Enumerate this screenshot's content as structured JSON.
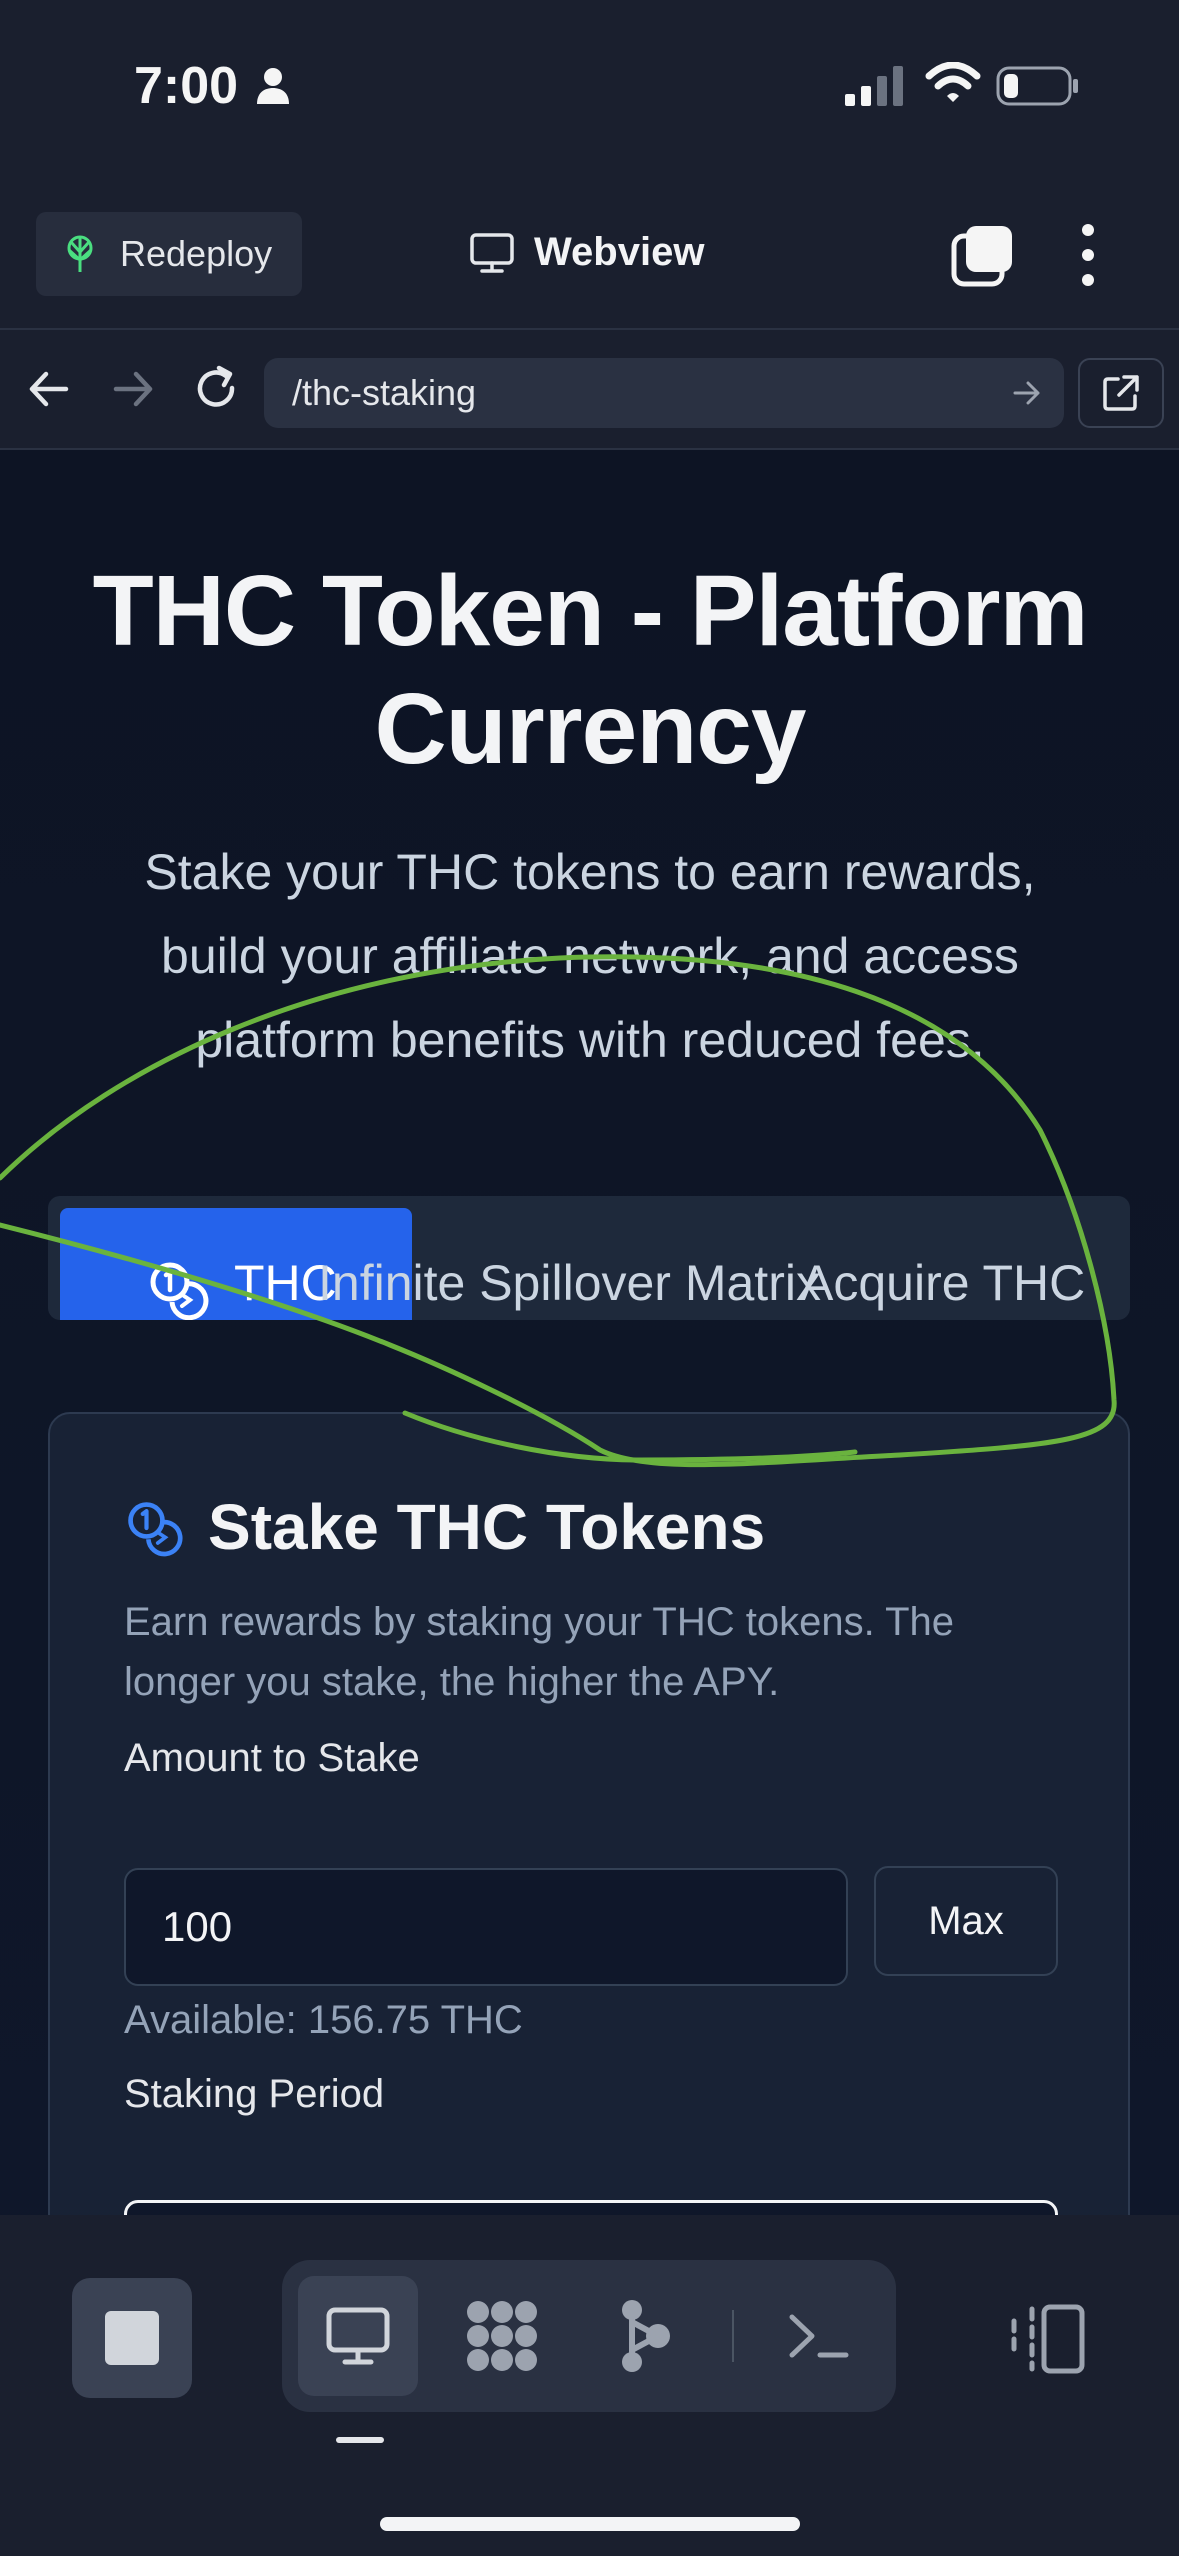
{
  "status_bar": {
    "time": "7:00"
  },
  "toolbar": {
    "redeploy_label": "Redeploy",
    "webview_label": "Webview"
  },
  "nav": {
    "url": "/thc-staking"
  },
  "page": {
    "title_line1": "THC Token - Platform",
    "title_line2": "Currency",
    "subtitle_line1": "Stake your THC tokens to earn rewards,",
    "subtitle_line2": "build your affiliate network, and access",
    "subtitle_line3": "platform benefits with reduced fees."
  },
  "tabs": [
    {
      "label": "THC",
      "active": true
    },
    {
      "label": "Infinite Spillover Matrix",
      "active": false
    },
    {
      "label": "Acquire THC",
      "active": false
    }
  ],
  "stake_card": {
    "title": "Stake THC Tokens",
    "description_line1": "Earn rewards by staking your THC tokens. The",
    "description_line2": "longer you stake, the higher the APY.",
    "amount_label": "Amount to Stake",
    "amount_value": "100",
    "max_label": "Max",
    "available": "Available: 156.75 THC",
    "period_label": "Staking Period"
  },
  "colors": {
    "accent": "#2563eb",
    "annotation": "#6ab33e",
    "background": "#0f172a"
  },
  "icons": [
    "person-icon",
    "signal-icon",
    "wifi-icon",
    "battery-icon",
    "redeploy-icon",
    "monitor-icon",
    "tabs-icon",
    "more-icon",
    "back-icon",
    "forward-icon",
    "reload-icon",
    "go-icon",
    "external-link-icon",
    "coins-icon",
    "stop-icon",
    "grid-icon",
    "graph-icon",
    "terminal-icon",
    "panel-icon"
  ]
}
